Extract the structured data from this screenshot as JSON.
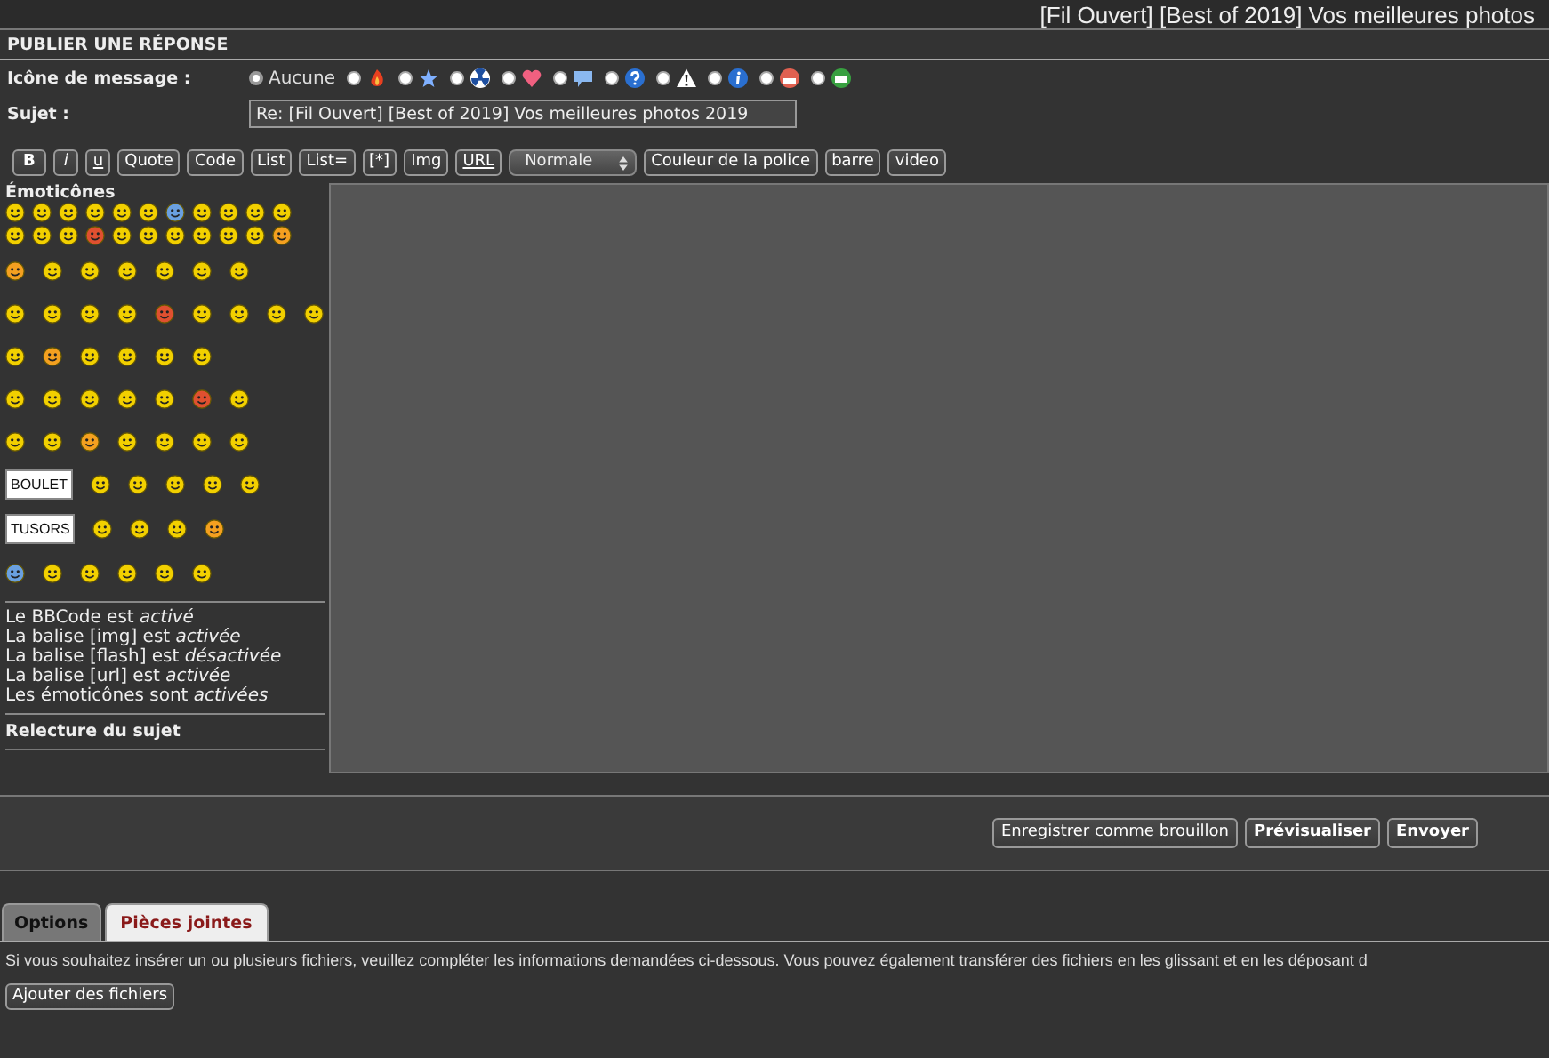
{
  "page_title": "[Fil Ouvert] [Best of 2019] Vos meilleures photos",
  "section_title": "PUBLIER UNE RÉPONSE",
  "message_icon": {
    "label": "Icône de message :",
    "options": [
      {
        "kind": "none",
        "label": "Aucune",
        "selected": true
      },
      {
        "kind": "fire",
        "selected": false
      },
      {
        "kind": "star",
        "selected": false
      },
      {
        "kind": "radioactive",
        "selected": false
      },
      {
        "kind": "heart",
        "selected": false
      },
      {
        "kind": "bubble",
        "selected": false
      },
      {
        "kind": "question",
        "selected": false
      },
      {
        "kind": "warning",
        "selected": false
      },
      {
        "kind": "info",
        "selected": false
      },
      {
        "kind": "mad",
        "selected": false
      },
      {
        "kind": "grin",
        "selected": false
      }
    ]
  },
  "subject": {
    "label": "Sujet :",
    "value": "Re: [Fil Ouvert] [Best of 2019] Vos meilleures photos 2019"
  },
  "toolbar": [
    {
      "kind": "bold",
      "label": "B"
    },
    {
      "kind": "italic",
      "label": "i"
    },
    {
      "kind": "underline",
      "label": "u"
    },
    {
      "kind": "button",
      "label": "Quote"
    },
    {
      "kind": "button",
      "label": "Code"
    },
    {
      "kind": "button",
      "label": "List"
    },
    {
      "kind": "button",
      "label": "List="
    },
    {
      "kind": "button",
      "label": "[*]"
    },
    {
      "kind": "button",
      "label": "Img"
    },
    {
      "kind": "underline",
      "label": "URL"
    },
    {
      "kind": "select",
      "label": "Normale"
    },
    {
      "kind": "button",
      "label": "Couleur de la police"
    },
    {
      "kind": "button",
      "label": "barre"
    },
    {
      "kind": "button",
      "label": "video"
    }
  ],
  "emoticons": {
    "title": "Émoticônes",
    "signs": [
      "BOULET",
      "TUSORS"
    ]
  },
  "status_lines": [
    "Le BBCode est *activé*",
    "La balise [img] est *activée*",
    "La balise [flash] est *désactivée*",
    "La balise [url] est *activée*",
    "Les émoticônes sont *activées*"
  ],
  "review_link": "Relecture du sujet",
  "actions": [
    {
      "label": "Enregistrer comme brouillon",
      "primary": false
    },
    {
      "label": "Prévisualiser",
      "primary": true
    },
    {
      "label": "Envoyer",
      "primary": true
    }
  ],
  "tabs": [
    {
      "label": "Options",
      "selected": false
    },
    {
      "label": "Pièces jointes",
      "selected": true
    }
  ],
  "attachments": {
    "note": "Si vous souhaitez insérer un ou plusieurs fichiers, veuillez compléter les informations demandées ci-dessous. Vous pouvez également transférer des fichiers en les glissant et en les déposant d",
    "button": "Ajouter des fichiers"
  }
}
